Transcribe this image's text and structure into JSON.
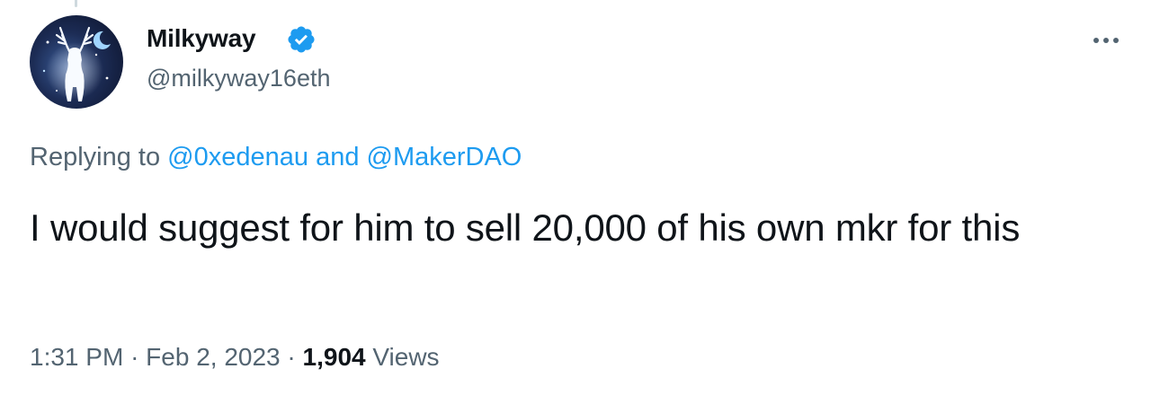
{
  "tweet": {
    "author": {
      "display_name": "Milkyway",
      "handle": "@milkyway16eth",
      "verified": true
    },
    "reply_context": {
      "prefix": "Replying to",
      "mentions": [
        "@0xedenau",
        "@MakerDAO"
      ],
      "joiner": "and"
    },
    "text": "I would suggest for him to sell 20,000 of his own mkr for this",
    "time": "1:31 PM",
    "separator": "·",
    "date": "Feb 2, 2023",
    "views_count": "1,904",
    "views_label": "Views"
  },
  "icons": {
    "verified": "verified-badge-icon",
    "more": "more-horizontal-icon",
    "avatar": "stag-silhouette-avatar"
  },
  "colors": {
    "accent": "#1d9bf0",
    "text_primary": "#0f1419",
    "text_secondary": "#536471",
    "thread_line": "#cfd9de"
  }
}
